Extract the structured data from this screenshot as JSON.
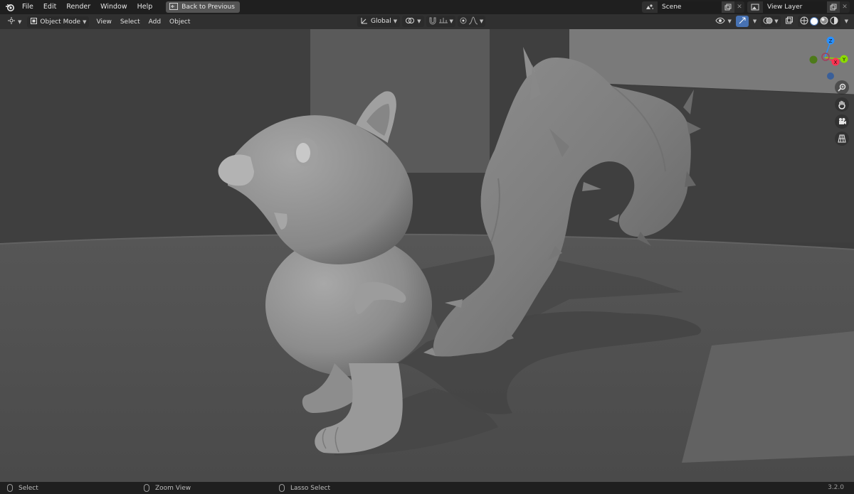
{
  "topbar": {
    "logo_icon": "blender-logo-icon",
    "menus": [
      "File",
      "Edit",
      "Render",
      "Window",
      "Help"
    ],
    "back_button_label": "Back to Previous",
    "scene_name": "Scene",
    "view_layer_name": "View Layer"
  },
  "viewport_header": {
    "editor_type_icon": "3d-viewport-icon",
    "mode_label": "Object Mode",
    "menus": [
      "View",
      "Select",
      "Add",
      "Object"
    ],
    "transform_orientation": "Global"
  },
  "viewport": {
    "background_color": "#3d3d3d",
    "gizmo_axes": [
      "Z",
      "X",
      "Y"
    ],
    "axis_colors": {
      "x": "#ff3352",
      "y": "#8bdc00",
      "z": "#2890ff"
    },
    "nav_tools": [
      "zoom-icon",
      "hand-pan-icon",
      "camera-icon",
      "grid-ortho-icon"
    ]
  },
  "statusbar": {
    "select_label": "Select",
    "zoom_label": "Zoom View",
    "lasso_label": "Lasso Select",
    "version": "3.2.0"
  }
}
